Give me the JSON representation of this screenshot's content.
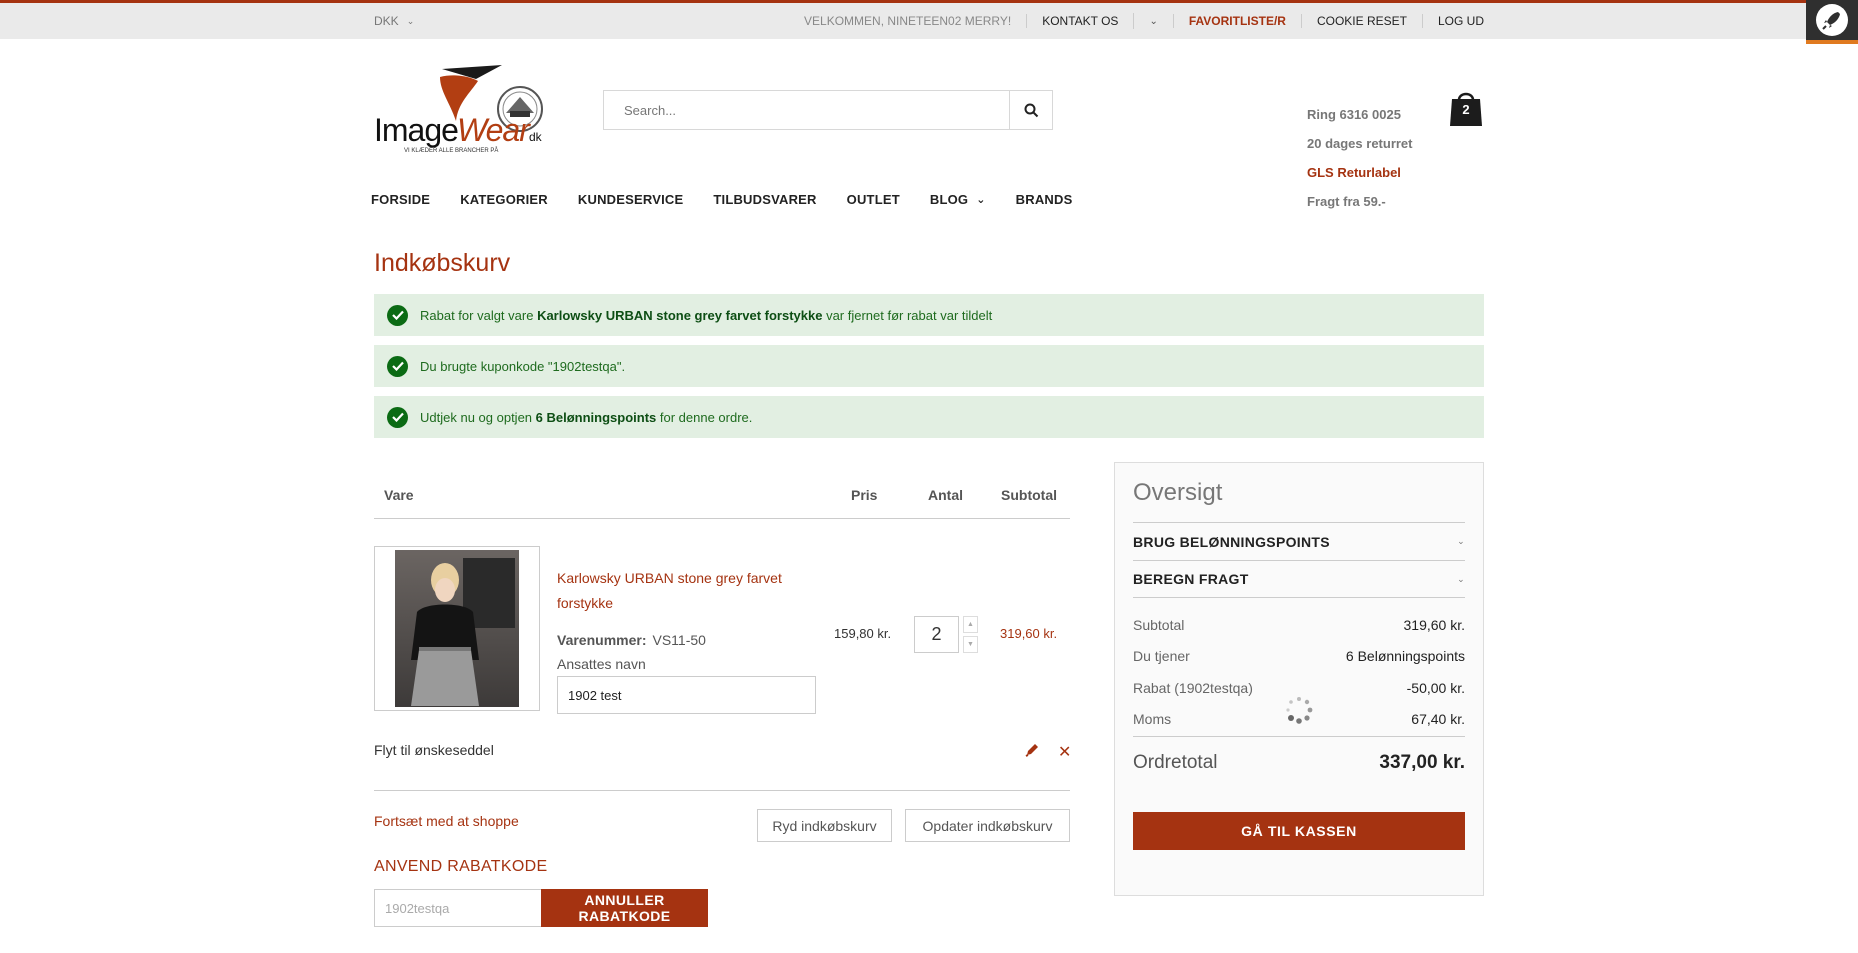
{
  "topbar": {
    "currency": "DKK",
    "welcome": "VELKOMMEN, NINETEEN02 MERRY!",
    "contact": "KONTAKT OS",
    "wishlist": "FAVORITLISTE/R",
    "cookie": "COOKIE RESET",
    "logout": "LOG UD"
  },
  "header": {
    "search_placeholder": "Search...",
    "cart_count": "2",
    "info": [
      "Ring 6316 0025",
      "20 dages returret",
      "GLS Returlabel",
      "Fragt fra 59.-"
    ],
    "logo_text": "ImageWear.dk",
    "logo_tagline": "VI KLÆDER ALLE BRANCHER PÅ"
  },
  "nav": [
    "FORSIDE",
    "KATEGORIER",
    "KUNDESERVICE",
    "TILBUDSVARER",
    "OUTLET",
    "BLOG",
    "BRANDS"
  ],
  "page": {
    "title": "Indkøbskurv"
  },
  "messages": [
    {
      "pre": "Rabat for valgt vare ",
      "bold": "Karlowsky URBAN stone grey farvet forstykke",
      "post": " var fjernet før rabat var tildelt"
    },
    {
      "pre": "Du brugte kuponkode \"1902testqa\".",
      "bold": "",
      "post": ""
    },
    {
      "pre": "Udtjek nu og optjen ",
      "bold": "6 Belønningspoints",
      "post": " for denne ordre."
    }
  ],
  "table": {
    "headers": {
      "item": "Vare",
      "price": "Pris",
      "qty": "Antal",
      "subtotal": "Subtotal"
    }
  },
  "item": {
    "name": "Karlowsky URBAN stone grey farvet forstykke",
    "sku_label": "Varenummer:",
    "sku": "VS11-50",
    "employee_label": "Ansattes navn",
    "employee_value": "1902 test",
    "price": "159,80 kr.",
    "qty": "2",
    "subtotal": "319,60 kr.",
    "move_to_wishlist": "Flyt til ønskeseddel"
  },
  "actions": {
    "continue": "Fortsæt med at shoppe",
    "clear": "Ryd indkøbskurv",
    "update": "Opdater indkøbskurv"
  },
  "coupon": {
    "title": "ANVEND RABATKODE",
    "value": "1902testqa",
    "cancel": "ANNULLER RABATKODE"
  },
  "summary": {
    "title": "Oversigt",
    "acc1": "BRUG BELØNNINGSPOINTS",
    "acc2": "BEREGN FRAGT",
    "rows": [
      {
        "label": "Subtotal",
        "value": "319,60 kr."
      },
      {
        "label": "Du tjener",
        "value": "6 Belønningspoints"
      },
      {
        "label": "Rabat (1902testqa)",
        "value": "-50,00 kr."
      },
      {
        "label": "Moms",
        "value": "67,40 kr."
      }
    ],
    "total_label": "Ordretotal",
    "total_value": "337,00 kr.",
    "checkout": "GÅ TIL KASSEN"
  },
  "colors": {
    "brand": "#a53311",
    "success_bg": "#e2efe2",
    "success_icon": "#0b6b14"
  }
}
